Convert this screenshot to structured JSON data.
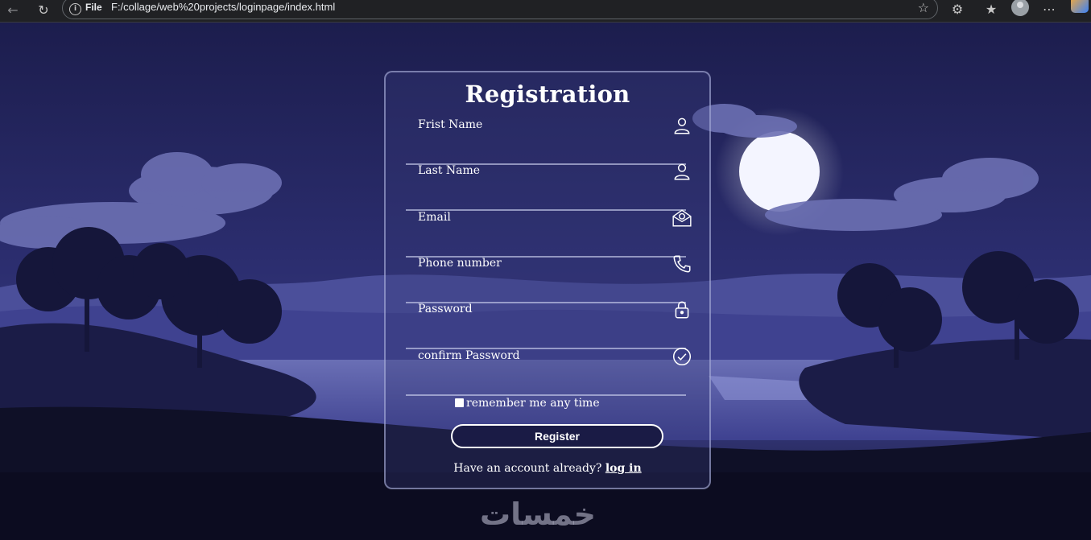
{
  "browser": {
    "protocol_label": "File",
    "url": "F:/collage/web%20projects/loginpage/index.html",
    "icons": [
      "back-icon",
      "reload-icon",
      "info-icon",
      "star-icon",
      "extensions-icon",
      "favorites-icon",
      "profile-avatar",
      "more-icon"
    ]
  },
  "form": {
    "title": "Registration",
    "fields": [
      {
        "label": "Frist Name",
        "icon": "user-icon"
      },
      {
        "label": "Last Name",
        "icon": "user-icon"
      },
      {
        "label": "Email",
        "icon": "email-icon"
      },
      {
        "label": "Phone number",
        "icon": "phone-icon"
      },
      {
        "label": "Password",
        "icon": "lock-icon"
      },
      {
        "label": "confirm Password",
        "icon": "check-circle-icon"
      }
    ],
    "remember_label": "remember me any time",
    "remember_checked": false,
    "register_label": "Register",
    "login_prompt": "Have an account already?",
    "login_link": "log in"
  },
  "watermark": "خمسات",
  "colors": {
    "accent": "#ffffff",
    "card_border": "#bec3eb",
    "sky": "#1b1c45"
  }
}
